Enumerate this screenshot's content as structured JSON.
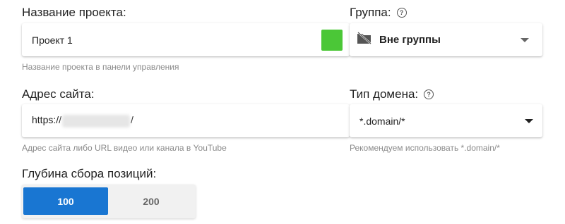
{
  "project": {
    "label": "Название проекта:",
    "value": "Проект 1",
    "hint": "Название проекта в панели управления",
    "color": "#4bc737"
  },
  "group": {
    "label": "Группа:",
    "help_icon": "help-circle-icon",
    "folder_icon": "folder-off-icon",
    "selected": "Вне группы"
  },
  "site": {
    "label": "Адрес сайта:",
    "value_prefix": "https://",
    "value_suffix": "/",
    "hint": "Адрес сайта либо URL видео или канала в YouTube"
  },
  "domain_type": {
    "label": "Тип домена:",
    "help_icon": "help-circle-icon",
    "selected": "*.domain/*",
    "hint": "Рекомендуем использовать *.domain/*"
  },
  "depth": {
    "label": "Глубина сбора позиций:",
    "options": [
      "100",
      "200"
    ],
    "selected": "100",
    "accent": "#1976d2"
  }
}
